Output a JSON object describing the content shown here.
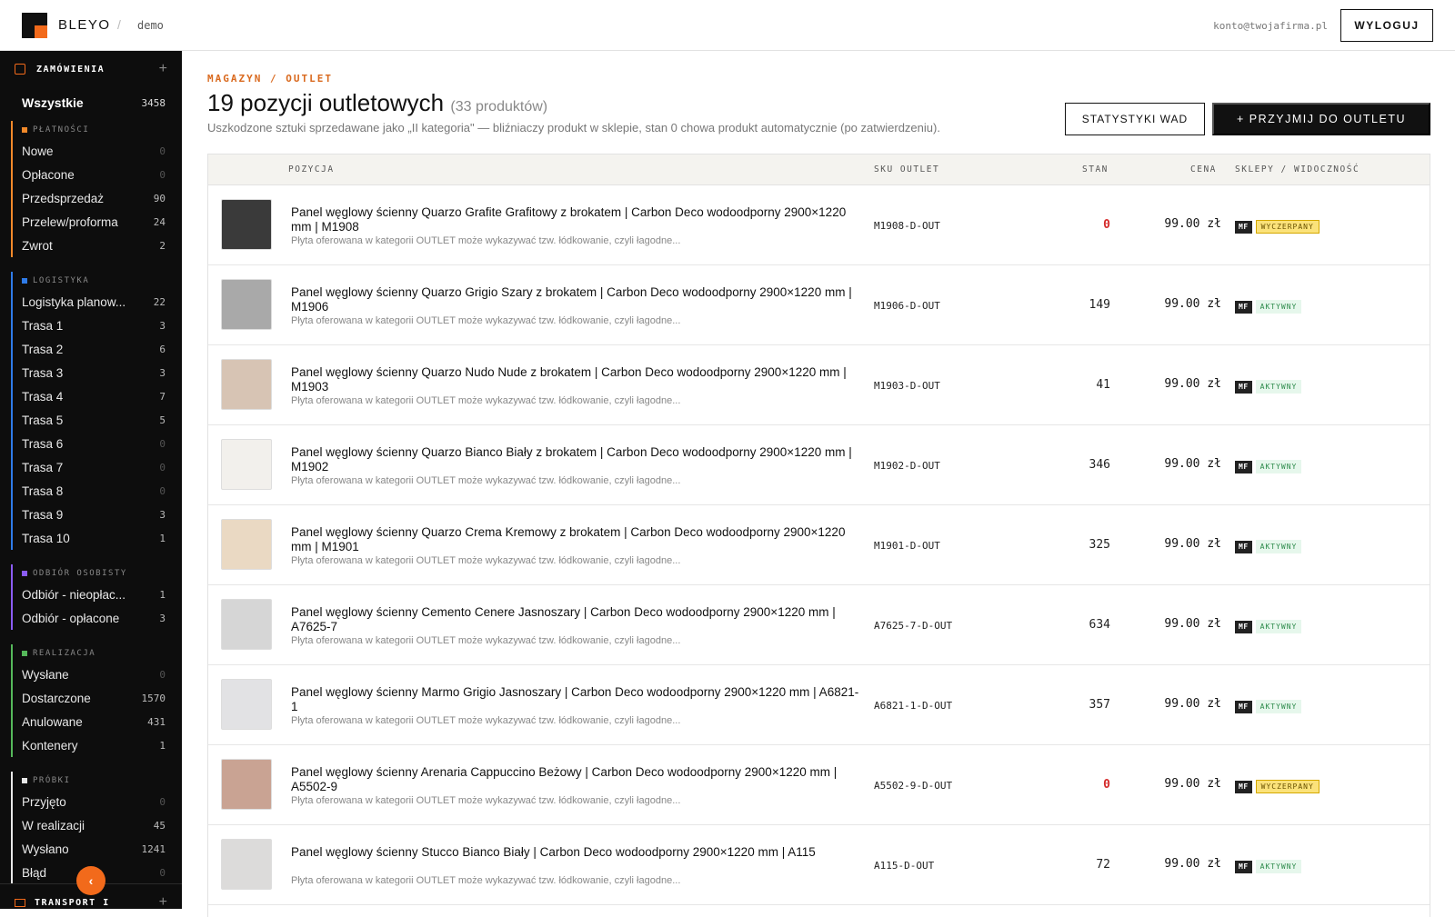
{
  "header": {
    "brand": "BLEYO",
    "separator": "/",
    "env": "demo",
    "account": "konto@twojafirma.pl",
    "logout_label": "WYLOGUJ"
  },
  "sidebar": {
    "section_label": "ZAMÓWIENIA",
    "all_label": "Wszystkie",
    "all_count": "3458",
    "groups": [
      {
        "label": "PŁATNOŚCI",
        "color": "#f2892a",
        "items": [
          {
            "label": "Nowe",
            "count": "0"
          },
          {
            "label": "Opłacone",
            "count": "0"
          },
          {
            "label": "Przedsprzedaż",
            "count": "90"
          },
          {
            "label": "Przelew/proforma",
            "count": "24"
          },
          {
            "label": "Zwrot",
            "count": "2"
          }
        ]
      },
      {
        "label": "LOGISTYKA",
        "color": "#2f7be8",
        "items": [
          {
            "label": "Logistyka planow...",
            "count": "22"
          },
          {
            "label": "Trasa 1",
            "count": "3"
          },
          {
            "label": "Trasa 2",
            "count": "6"
          },
          {
            "label": "Trasa 3",
            "count": "3"
          },
          {
            "label": "Trasa 4",
            "count": "7"
          },
          {
            "label": "Trasa 5",
            "count": "5"
          },
          {
            "label": "Trasa 6",
            "count": "0"
          },
          {
            "label": "Trasa 7",
            "count": "0"
          },
          {
            "label": "Trasa 8",
            "count": "0"
          },
          {
            "label": "Trasa 9",
            "count": "3"
          },
          {
            "label": "Trasa 10",
            "count": "1"
          }
        ]
      },
      {
        "label": "ODBIÓR OSOBISTY",
        "color": "#8b5cf6",
        "items": [
          {
            "label": "Odbiór - nieopłac...",
            "count": "1"
          },
          {
            "label": "Odbiór - opłacone",
            "count": "3"
          }
        ]
      },
      {
        "label": "REALIZACJA",
        "color": "#55b85a",
        "items": [
          {
            "label": "Wysłane",
            "count": "0"
          },
          {
            "label": "Dostarczone",
            "count": "1570"
          },
          {
            "label": "Anulowane",
            "count": "431"
          },
          {
            "label": "Kontenery",
            "count": "1"
          }
        ]
      },
      {
        "label": "PRÓBKI",
        "color": "#e8e8e8",
        "items": [
          {
            "label": "Przyjęto",
            "count": "0"
          },
          {
            "label": "W realizacji",
            "count": "45"
          },
          {
            "label": "Wysłano",
            "count": "1241"
          },
          {
            "label": "Błąd",
            "count": "0"
          }
        ]
      }
    ],
    "footer_label": "TRANSPORT I",
    "collapse_glyph": "‹"
  },
  "main": {
    "breadcrumb": "MAGAZYN / OUTLET",
    "title": "19 pozycji outletowych",
    "subtitle": "(33 produktów)",
    "description": "Uszkodzone sztuki sprzedawane jako „II kategoria\" — bliźniaczy produkt w sklepie, stan 0 chowa produkt automatycznie (po zatwierdzeniu).",
    "stats_button": "STATYSTYKI WAD",
    "accept_button": "+ PRZYJMIJ DO OUTLETU",
    "columns": {
      "position": "POZYCJA",
      "sku": "SKU OUTLET",
      "stock": "STAN",
      "price": "CENA",
      "shops": "SKLEPY / WIDOCZNOŚĆ"
    },
    "rows": [
      {
        "name": "Panel węglowy ścienny Quarzo Grafite Grafitowy z brokatem | Carbon Deco wodoodporny 2900×1220 mm | M1908",
        "desc": "Płyta oferowana w kategorii OUTLET może wykazywać tzw. łódkowanie, czyli łagodne...",
        "sku": "M1908-D-OUT",
        "stock": "0",
        "price": "99.00 zł",
        "shop": "MF",
        "status": "WYCZERPANY",
        "swatch": "#3a3a3a"
      },
      {
        "name": "Panel węglowy ścienny Quarzo Grigio Szary z brokatem | Carbon Deco wodoodporny 2900×1220 mm | M1906",
        "desc": "Płyta oferowana w kategorii OUTLET może wykazywać tzw. łódkowanie, czyli łagodne...",
        "sku": "M1906-D-OUT",
        "stock": "149",
        "price": "99.00 zł",
        "shop": "MF",
        "status": "AKTYWNY",
        "swatch": "#a9a9a9"
      },
      {
        "name": "Panel węglowy ścienny Quarzo Nudo Nude z brokatem | Carbon Deco wodoodporny 2900×1220 mm | M1903",
        "desc": "Płyta oferowana w kategorii OUTLET może wykazywać tzw. łódkowanie, czyli łagodne...",
        "sku": "M1903-D-OUT",
        "stock": "41",
        "price": "99.00 zł",
        "shop": "MF",
        "status": "AKTYWNY",
        "swatch": "#d7c4b4"
      },
      {
        "name": "Panel węglowy ścienny Quarzo Bianco Biały z brokatem | Carbon Deco wodoodporny 2900×1220 mm | M1902",
        "desc": "Płyta oferowana w kategorii OUTLET może wykazywać tzw. łódkowanie, czyli łagodne...",
        "sku": "M1902-D-OUT",
        "stock": "346",
        "price": "99.00 zł",
        "shop": "MF",
        "status": "AKTYWNY",
        "swatch": "#f2f0ec"
      },
      {
        "name": "Panel węglowy ścienny Quarzo Crema Kremowy z brokatem | Carbon Deco wodoodporny 2900×1220 mm | M1901",
        "desc": "Płyta oferowana w kategorii OUTLET może wykazywać tzw. łódkowanie, czyli łagodne...",
        "sku": "M1901-D-OUT",
        "stock": "325",
        "price": "99.00 zł",
        "shop": "MF",
        "status": "AKTYWNY",
        "swatch": "#ead9c3"
      },
      {
        "name": "Panel węglowy ścienny Cemento Cenere Jasnoszary | Carbon Deco wodoodporny 2900×1220 mm | A7625-7",
        "desc": "Płyta oferowana w kategorii OUTLET może wykazywać tzw. łódkowanie, czyli łagodne...",
        "sku": "A7625-7-D-OUT",
        "stock": "634",
        "price": "99.00 zł",
        "shop": "MF",
        "status": "AKTYWNY",
        "swatch": "#d6d6d6"
      },
      {
        "name": "Panel węglowy ścienny Marmo Grigio Jasnoszary | Carbon Deco wodoodporny 2900×1220 mm | A6821-1",
        "desc": "Płyta oferowana w kategorii OUTLET może wykazywać tzw. łódkowanie, czyli łagodne...",
        "sku": "A6821-1-D-OUT",
        "stock": "357",
        "price": "99.00 zł",
        "shop": "MF",
        "status": "AKTYWNY",
        "swatch": "#e2e2e4"
      },
      {
        "name": "Panel węglowy ścienny Arenaria Cappuccino Beżowy | Carbon Deco wodoodporny 2900×1220 mm | A5502-9",
        "desc": "Płyta oferowana w kategorii OUTLET może wykazywać tzw. łódkowanie, czyli łagodne...",
        "sku": "A5502-9-D-OUT",
        "stock": "0",
        "price": "99.00 zł",
        "shop": "MF",
        "status": "WYCZERPANY",
        "swatch": "#c9a393"
      },
      {
        "name": "Panel węglowy ścienny Stucco Bianco Biały | Carbon Deco wodoodporny 2900×1220 mm | A115",
        "desc": "Płyta oferowana w kategorii OUTLET może wykazywać tzw. łódkowanie, czyli łagodne...",
        "sku": "A115-D-OUT",
        "stock": "72",
        "price": "99.00 zł",
        "shop": "MF",
        "status": "AKTYWNY",
        "swatch": "#dcdbda"
      }
    ]
  }
}
